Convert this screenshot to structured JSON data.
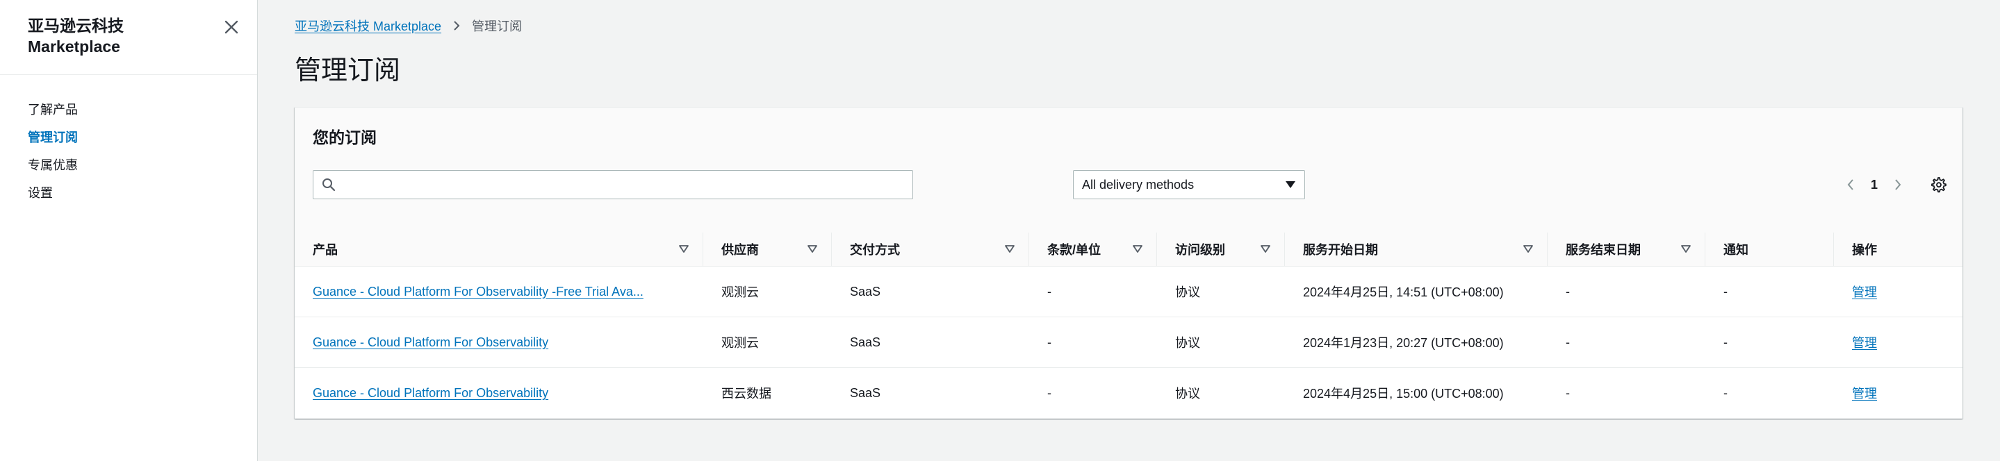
{
  "sidebar": {
    "title_line1": "亚马逊云科技",
    "title_line2": "Marketplace",
    "close_icon": "close-icon",
    "items": [
      {
        "label": "了解产品",
        "active": false
      },
      {
        "label": "管理订阅",
        "active": true
      },
      {
        "label": "专属优惠",
        "active": false
      },
      {
        "label": "设置",
        "active": false
      }
    ]
  },
  "breadcrumb": {
    "root": "亚马逊云科技 Marketplace",
    "current": "管理订阅"
  },
  "page_title": "管理订阅",
  "panel": {
    "title": "您的订阅",
    "search_placeholder": "",
    "delivery_select": "All delivery methods",
    "page": "1"
  },
  "table": {
    "headers": [
      "产品",
      "供应商",
      "交付方式",
      "条款/单位",
      "访问级别",
      "服务开始日期",
      "服务结束日期",
      "通知",
      "操作"
    ],
    "rows": [
      {
        "product": "Guance - Cloud Platform For Observability -Free Trial Ava...",
        "vendor": "观测云",
        "delivery": "SaaS",
        "terms": "-",
        "access": "协议",
        "start": "2024年4月25日, 14:51 (UTC+08:00)",
        "end": "-",
        "notice": "-",
        "action": "管理"
      },
      {
        "product": "Guance - Cloud Platform For Observability",
        "vendor": "观测云",
        "delivery": "SaaS",
        "terms": "-",
        "access": "协议",
        "start": "2024年1月23日, 20:27 (UTC+08:00)",
        "end": "-",
        "notice": "-",
        "action": "管理"
      },
      {
        "product": "Guance - Cloud Platform For Observability",
        "vendor": "西云数据",
        "delivery": "SaaS",
        "terms": "-",
        "access": "协议",
        "start": "2024年4月25日, 15:00 (UTC+08:00)",
        "end": "-",
        "notice": "-",
        "action": "管理"
      }
    ]
  },
  "colors": {
    "link": "#0073bb",
    "text": "#16191f",
    "background": "#f2f3f3"
  }
}
